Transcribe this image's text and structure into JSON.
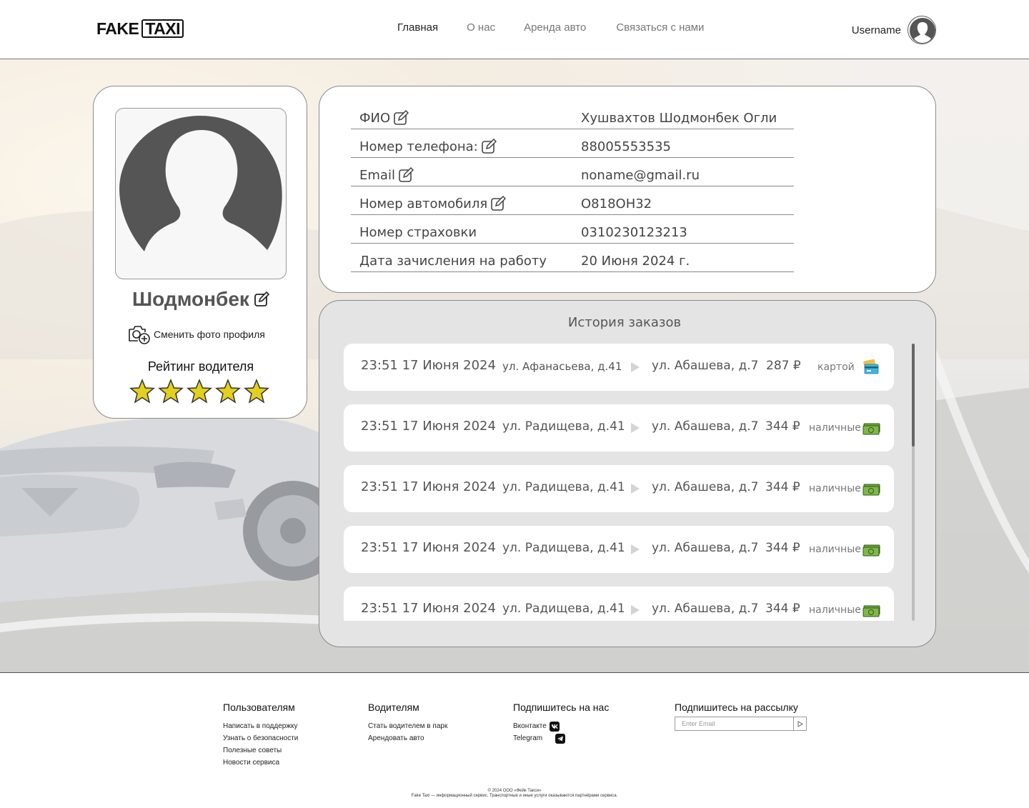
{
  "header": {
    "logo_fake": "FAKE",
    "logo_taxi": "TAXI",
    "nav": [
      "Главная",
      "О нас",
      "Аренда авто",
      "Связаться с нами"
    ],
    "username": "Username"
  },
  "profile": {
    "name": "Шодмонбек",
    "change_photo": "Сменить фото профиля",
    "rating_label": "Рейтинг водителя",
    "rating": 5,
    "rating_max": 5
  },
  "info": {
    "rows": [
      {
        "label": "ФИО",
        "value": "Хушвахтов Шодмонбек Огли",
        "editable": true
      },
      {
        "label": "Номер телефона:",
        "value": "88005553535",
        "editable": true
      },
      {
        "label": "Email",
        "value": "noname@gmail.ru",
        "editable": true
      },
      {
        "label": "Номер автомобиля",
        "value": "О818ОН32",
        "editable": true
      },
      {
        "label": "Номер страховки",
        "value": "0310230123213",
        "editable": false
      },
      {
        "label": "Дата зачисления на работу",
        "value": "20 Июня 2024 г.",
        "editable": false
      }
    ]
  },
  "orders": {
    "title": "История заказов",
    "items": [
      {
        "time": "23:51 17 Июня 2024",
        "from": "ул. Афанасьева, д.41",
        "to": "ул. Абашева, д.7",
        "price": "287 ₽",
        "payment": "картой",
        "payment_icon": "credit-card-icon"
      },
      {
        "time": "23:51 17 Июня 2024",
        "from": "ул. Радищева, д.41",
        "to": "ул. Абашева, д.7",
        "price": "344 ₽",
        "payment": "наличные",
        "payment_icon": "cash-icon"
      },
      {
        "time": "23:51 17 Июня 2024",
        "from": "ул. Радищева, д.41",
        "to": "ул. Абашева, д.7",
        "price": "344 ₽",
        "payment": "наличные",
        "payment_icon": "cash-icon"
      },
      {
        "time": "23:51 17 Июня 2024",
        "from": "ул. Радищева, д.41",
        "to": "ул. Абашева, д.7",
        "price": "344 ₽",
        "payment": "наличные",
        "payment_icon": "cash-icon"
      },
      {
        "time": "23:51 17 Июня 2024",
        "from": "ул. Радищева, д.41",
        "to": "ул. Абашева, д.7",
        "price": "344 ₽",
        "payment": "наличные",
        "payment_icon": "cash-icon"
      }
    ]
  },
  "footer": {
    "users": {
      "title": "Пользователям",
      "links": [
        "Написать в поддержку",
        "Узнать о безопасности",
        "Полезные советы",
        "Новости сервиса"
      ]
    },
    "drivers": {
      "title": "Водителям",
      "links": [
        "Стать водителем в парк",
        "Арендовать авто"
      ]
    },
    "social": {
      "title": "Подпишитесь на нас",
      "links": [
        "Вконтакте",
        "Telegram"
      ]
    },
    "newsletter": {
      "title": "Подпишитесь на рассылку",
      "placeholder": "Enter Email"
    },
    "copyright": "© 2024 ООО «Фейк Такси»",
    "disclaimer": "Fake Taxi — информационный сервис. Транспортные и иные услуги оказываются партнёрами сервиса."
  },
  "colors": {
    "star": "#e2cf1e",
    "cash": "#6ea63a",
    "card_blue": "#3fb6e0",
    "icon_gray": "#555555"
  }
}
